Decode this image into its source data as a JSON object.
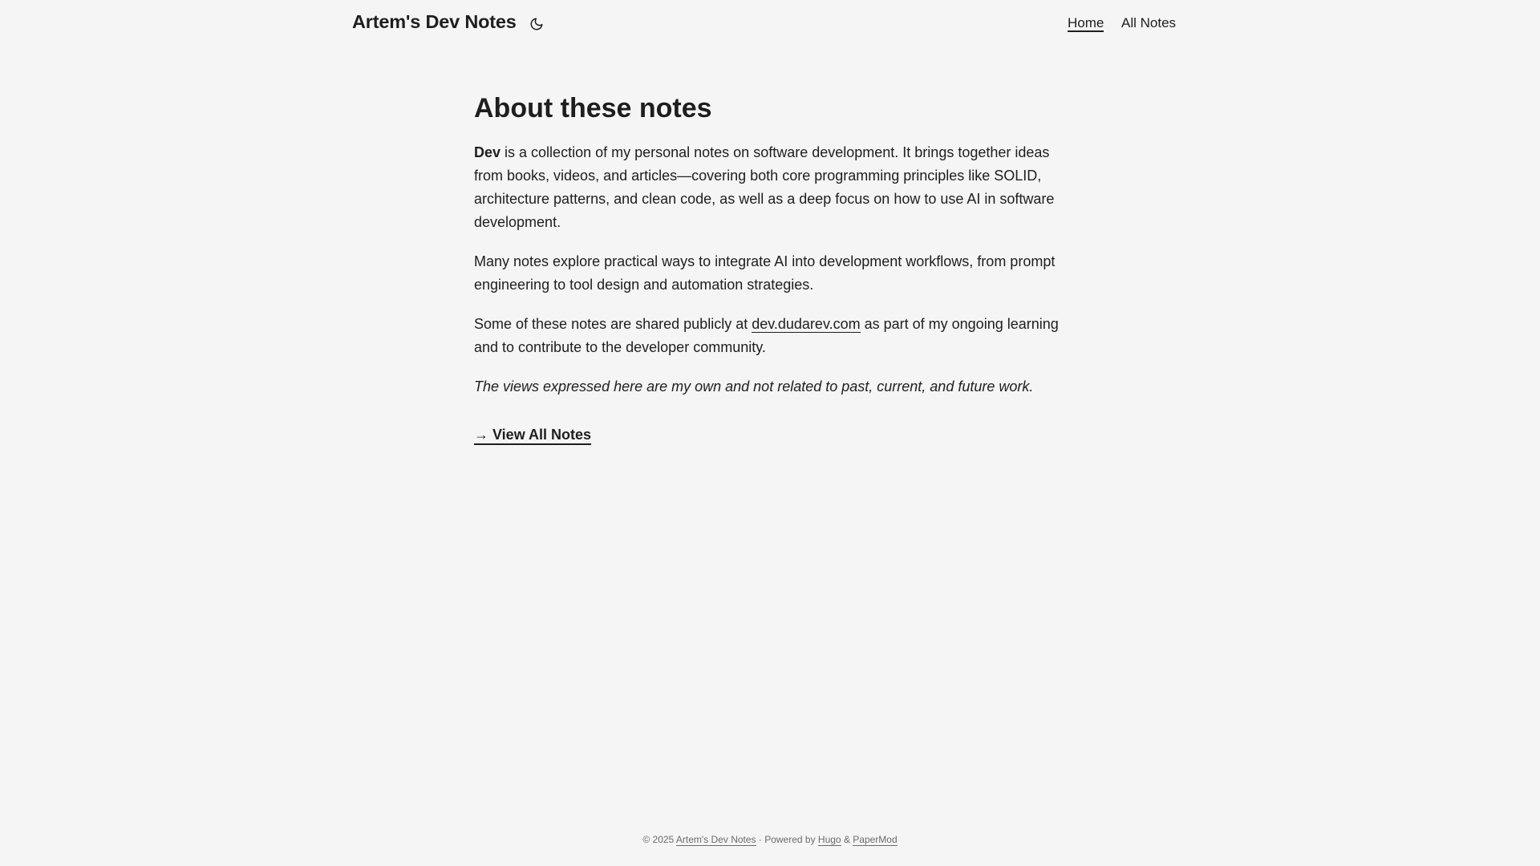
{
  "header": {
    "logo": "Artem's Dev Notes",
    "theme_toggle_icon": "moon-icon",
    "nav": {
      "home": "Home",
      "all_notes": "All Notes"
    }
  },
  "main": {
    "title": "About these notes",
    "p1_strong": "Dev",
    "p1_rest": " is a collection of my personal notes on software development. It brings together ideas from books, videos, and articles—covering both core programming principles like SOLID, architecture patterns, and clean code, as well as a deep focus on how to use AI in software development.",
    "p2": "Many notes explore practical ways to integrate AI into development workflows, from prompt engineering to tool design and automation strategies.",
    "p3_before": "Some of these notes are shared publicly at ",
    "p3_link": "dev.dudarev.com",
    "p3_after": " as part of my ongoing learning and to contribute to the developer community.",
    "p4": "The views expressed here are my own and not related to past, current, and future work.",
    "view_all": "→ View All Notes"
  },
  "footer": {
    "copyright": "© 2025 ",
    "site_link": "Artem's Dev Notes",
    "powered_by": " · Powered by ",
    "hugo": "Hugo",
    "amp": " & ",
    "papermod": "PaperMod"
  },
  "colors": {
    "background": "#f5f5f5",
    "text": "#1e1e1e",
    "footer_text": "#6b6b6b"
  }
}
